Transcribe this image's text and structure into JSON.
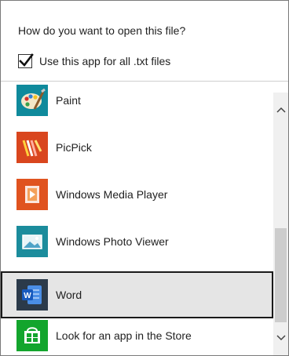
{
  "dialog": {
    "prompt": "How do you want to open this file?",
    "always_use": {
      "label": "Use this app for all .txt files",
      "checked": true
    }
  },
  "apps": [
    {
      "label": "Paint",
      "icon": "paint-palette-icon",
      "color": "#0f8a9c"
    },
    {
      "label": "PicPick",
      "icon": "picpick-icon",
      "color": "#d9461e"
    },
    {
      "label": "Windows Media Player",
      "icon": "media-player-icon",
      "color": "#e0531f"
    },
    {
      "label": "Windows Photo Viewer",
      "icon": "photo-viewer-icon",
      "color": "#1b8c9c"
    },
    {
      "label": "Word",
      "icon": "word-icon",
      "color": "#2b3a4a",
      "selected": true
    },
    {
      "label": "Look for an app in the Store",
      "icon": "store-icon",
      "color": "#13a52d"
    }
  ],
  "scrollbar": {
    "up_icon": "chevron-up-icon",
    "down_icon": "chevron-down-icon"
  }
}
